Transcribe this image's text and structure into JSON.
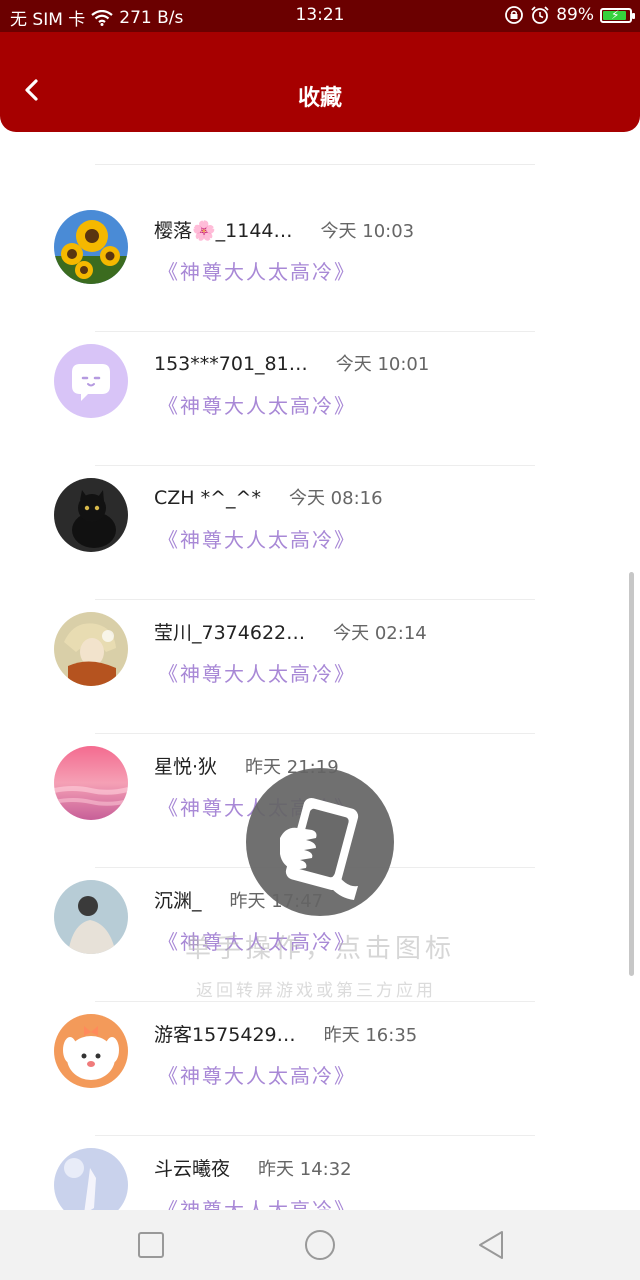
{
  "status_bar": {
    "carrier": "无 SIM 卡",
    "speed": "271 B/s",
    "time": "13:21",
    "battery": "89%",
    "battery_level": 0.89,
    "icons": [
      "wifi-icon",
      "lock-rotation-icon",
      "alarm-icon",
      "battery-icon"
    ]
  },
  "header": {
    "title": "收藏",
    "back_icon": "chevron-left-icon",
    "color": "#a60000"
  },
  "favorites": [
    {
      "name": "樱落🌸_1144…",
      "time": "今天  10:03",
      "book": "《神尊大人太高冷》"
    },
    {
      "name": "153***701_81…",
      "time": "今天  10:01",
      "book": "《神尊大人太高冷》"
    },
    {
      "name": "CZH *^_^*",
      "time": "今天  08:16",
      "book": "《神尊大人太高冷》"
    },
    {
      "name": "莹川_7374622…",
      "time": "今天  02:14",
      "book": "《神尊大人太高冷》"
    },
    {
      "name": "星悦·狄",
      "time": "昨天  21:19",
      "book": "《神尊大人太高冷》"
    },
    {
      "name": "沉渊_",
      "time": "昨天  17:47",
      "book": "《神尊大人太高冷》"
    },
    {
      "name": "游客1575429…",
      "time": "昨天  16:35",
      "book": "《神尊大人太高冷》"
    },
    {
      "name": "斗云曦夜",
      "time": "昨天  14:32",
      "book": "《神尊大人太高冷》"
    }
  ],
  "overlay": {
    "icon": "hand-holding-phone-icon",
    "hint_primary": "单手操作，点击图标",
    "hint_secondary": "返回转屏游戏或第三方应用"
  },
  "colors": {
    "accent": "#a60000",
    "status_bar": "#6b0000",
    "book_title": "#a888d6"
  },
  "nav_bar": {
    "icons": [
      "recent-apps-icon",
      "home-icon",
      "back-triangle-icon"
    ]
  }
}
